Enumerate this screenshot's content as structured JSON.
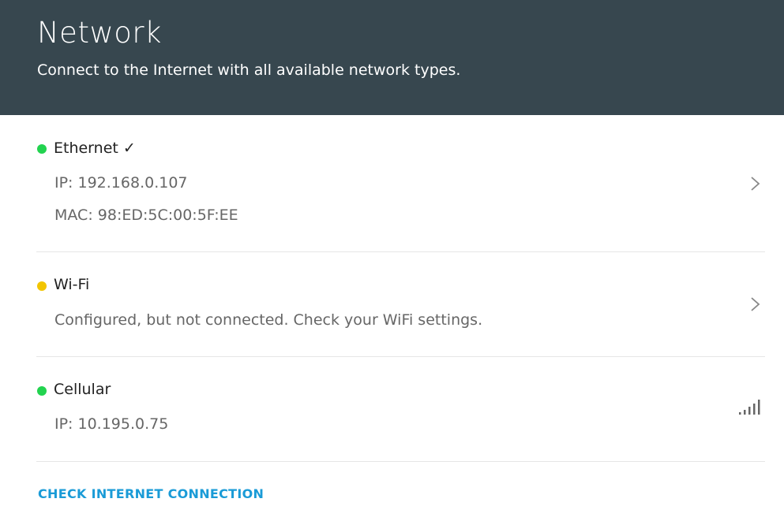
{
  "header": {
    "title": "Network",
    "subtitle": "Connect to the Internet with all available network types."
  },
  "ethernet": {
    "name": "Ethernet ✓",
    "status_color": "#22d34f",
    "ip": "IP: 192.168.0.107",
    "mac": "MAC: 98:ED:5C:00:5F:EE",
    "icon": "chevron-right-icon"
  },
  "wifi": {
    "name": "Wi-Fi",
    "status_color": "#f2c500",
    "message": "Configured, but not connected. Check your WiFi settings.",
    "icon": "chevron-right-icon"
  },
  "cellular": {
    "name": "Cellular",
    "status_color": "#22d34f",
    "ip": "IP: 10.195.0.75",
    "icon": "signal-strength-icon"
  },
  "actions": {
    "check_connection": "CHECK INTERNET CONNECTION"
  },
  "colors": {
    "header_bg": "#37474f",
    "accent": "#1a9bd7"
  }
}
